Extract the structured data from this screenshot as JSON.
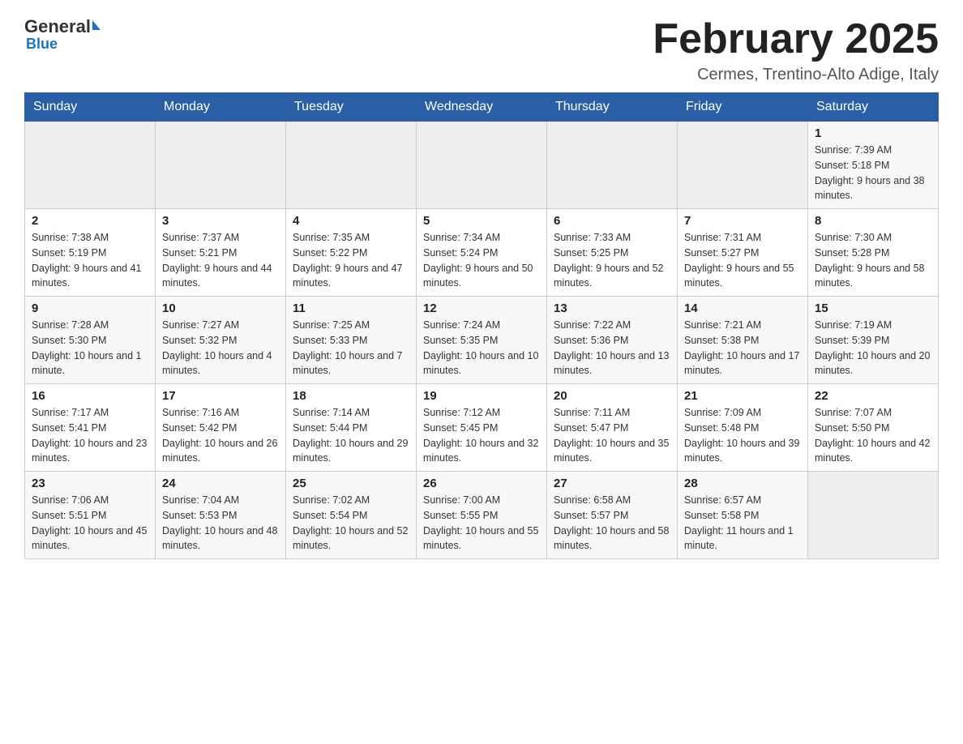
{
  "header": {
    "logo_general": "General",
    "logo_blue": "Blue",
    "title": "February 2025",
    "subtitle": "Cermes, Trentino-Alto Adige, Italy"
  },
  "weekdays": [
    "Sunday",
    "Monday",
    "Tuesday",
    "Wednesday",
    "Thursday",
    "Friday",
    "Saturday"
  ],
  "weeks": [
    [
      {
        "day": "",
        "sunrise": "",
        "sunset": "",
        "daylight": ""
      },
      {
        "day": "",
        "sunrise": "",
        "sunset": "",
        "daylight": ""
      },
      {
        "day": "",
        "sunrise": "",
        "sunset": "",
        "daylight": ""
      },
      {
        "day": "",
        "sunrise": "",
        "sunset": "",
        "daylight": ""
      },
      {
        "day": "",
        "sunrise": "",
        "sunset": "",
        "daylight": ""
      },
      {
        "day": "",
        "sunrise": "",
        "sunset": "",
        "daylight": ""
      },
      {
        "day": "1",
        "sunrise": "Sunrise: 7:39 AM",
        "sunset": "Sunset: 5:18 PM",
        "daylight": "Daylight: 9 hours and 38 minutes."
      }
    ],
    [
      {
        "day": "2",
        "sunrise": "Sunrise: 7:38 AM",
        "sunset": "Sunset: 5:19 PM",
        "daylight": "Daylight: 9 hours and 41 minutes."
      },
      {
        "day": "3",
        "sunrise": "Sunrise: 7:37 AM",
        "sunset": "Sunset: 5:21 PM",
        "daylight": "Daylight: 9 hours and 44 minutes."
      },
      {
        "day": "4",
        "sunrise": "Sunrise: 7:35 AM",
        "sunset": "Sunset: 5:22 PM",
        "daylight": "Daylight: 9 hours and 47 minutes."
      },
      {
        "day": "5",
        "sunrise": "Sunrise: 7:34 AM",
        "sunset": "Sunset: 5:24 PM",
        "daylight": "Daylight: 9 hours and 50 minutes."
      },
      {
        "day": "6",
        "sunrise": "Sunrise: 7:33 AM",
        "sunset": "Sunset: 5:25 PM",
        "daylight": "Daylight: 9 hours and 52 minutes."
      },
      {
        "day": "7",
        "sunrise": "Sunrise: 7:31 AM",
        "sunset": "Sunset: 5:27 PM",
        "daylight": "Daylight: 9 hours and 55 minutes."
      },
      {
        "day": "8",
        "sunrise": "Sunrise: 7:30 AM",
        "sunset": "Sunset: 5:28 PM",
        "daylight": "Daylight: 9 hours and 58 minutes."
      }
    ],
    [
      {
        "day": "9",
        "sunrise": "Sunrise: 7:28 AM",
        "sunset": "Sunset: 5:30 PM",
        "daylight": "Daylight: 10 hours and 1 minute."
      },
      {
        "day": "10",
        "sunrise": "Sunrise: 7:27 AM",
        "sunset": "Sunset: 5:32 PM",
        "daylight": "Daylight: 10 hours and 4 minutes."
      },
      {
        "day": "11",
        "sunrise": "Sunrise: 7:25 AM",
        "sunset": "Sunset: 5:33 PM",
        "daylight": "Daylight: 10 hours and 7 minutes."
      },
      {
        "day": "12",
        "sunrise": "Sunrise: 7:24 AM",
        "sunset": "Sunset: 5:35 PM",
        "daylight": "Daylight: 10 hours and 10 minutes."
      },
      {
        "day": "13",
        "sunrise": "Sunrise: 7:22 AM",
        "sunset": "Sunset: 5:36 PM",
        "daylight": "Daylight: 10 hours and 13 minutes."
      },
      {
        "day": "14",
        "sunrise": "Sunrise: 7:21 AM",
        "sunset": "Sunset: 5:38 PM",
        "daylight": "Daylight: 10 hours and 17 minutes."
      },
      {
        "day": "15",
        "sunrise": "Sunrise: 7:19 AM",
        "sunset": "Sunset: 5:39 PM",
        "daylight": "Daylight: 10 hours and 20 minutes."
      }
    ],
    [
      {
        "day": "16",
        "sunrise": "Sunrise: 7:17 AM",
        "sunset": "Sunset: 5:41 PM",
        "daylight": "Daylight: 10 hours and 23 minutes."
      },
      {
        "day": "17",
        "sunrise": "Sunrise: 7:16 AM",
        "sunset": "Sunset: 5:42 PM",
        "daylight": "Daylight: 10 hours and 26 minutes."
      },
      {
        "day": "18",
        "sunrise": "Sunrise: 7:14 AM",
        "sunset": "Sunset: 5:44 PM",
        "daylight": "Daylight: 10 hours and 29 minutes."
      },
      {
        "day": "19",
        "sunrise": "Sunrise: 7:12 AM",
        "sunset": "Sunset: 5:45 PM",
        "daylight": "Daylight: 10 hours and 32 minutes."
      },
      {
        "day": "20",
        "sunrise": "Sunrise: 7:11 AM",
        "sunset": "Sunset: 5:47 PM",
        "daylight": "Daylight: 10 hours and 35 minutes."
      },
      {
        "day": "21",
        "sunrise": "Sunrise: 7:09 AM",
        "sunset": "Sunset: 5:48 PM",
        "daylight": "Daylight: 10 hours and 39 minutes."
      },
      {
        "day": "22",
        "sunrise": "Sunrise: 7:07 AM",
        "sunset": "Sunset: 5:50 PM",
        "daylight": "Daylight: 10 hours and 42 minutes."
      }
    ],
    [
      {
        "day": "23",
        "sunrise": "Sunrise: 7:06 AM",
        "sunset": "Sunset: 5:51 PM",
        "daylight": "Daylight: 10 hours and 45 minutes."
      },
      {
        "day": "24",
        "sunrise": "Sunrise: 7:04 AM",
        "sunset": "Sunset: 5:53 PM",
        "daylight": "Daylight: 10 hours and 48 minutes."
      },
      {
        "day": "25",
        "sunrise": "Sunrise: 7:02 AM",
        "sunset": "Sunset: 5:54 PM",
        "daylight": "Daylight: 10 hours and 52 minutes."
      },
      {
        "day": "26",
        "sunrise": "Sunrise: 7:00 AM",
        "sunset": "Sunset: 5:55 PM",
        "daylight": "Daylight: 10 hours and 55 minutes."
      },
      {
        "day": "27",
        "sunrise": "Sunrise: 6:58 AM",
        "sunset": "Sunset: 5:57 PM",
        "daylight": "Daylight: 10 hours and 58 minutes."
      },
      {
        "day": "28",
        "sunrise": "Sunrise: 6:57 AM",
        "sunset": "Sunset: 5:58 PM",
        "daylight": "Daylight: 11 hours and 1 minute."
      },
      {
        "day": "",
        "sunrise": "",
        "sunset": "",
        "daylight": ""
      }
    ]
  ]
}
